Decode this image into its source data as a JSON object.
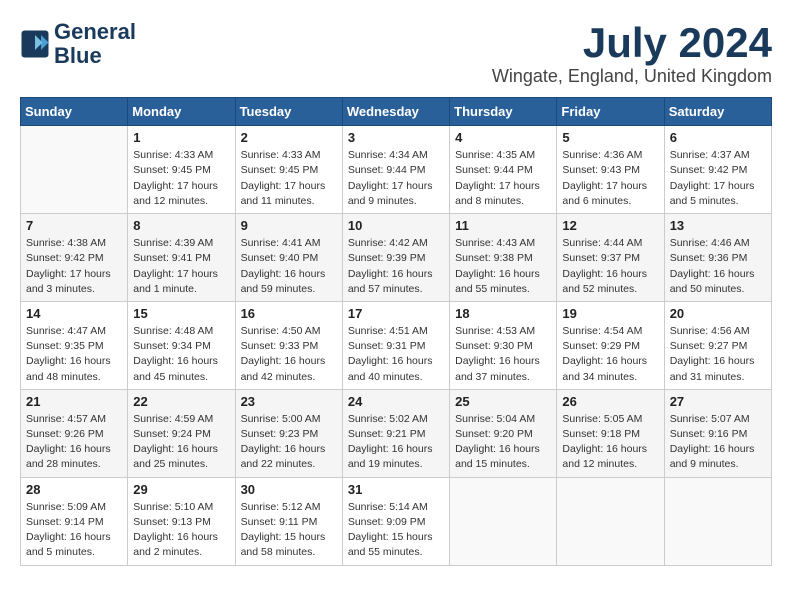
{
  "logo": {
    "line1": "General",
    "line2": "Blue"
  },
  "title": "July 2024",
  "location": "Wingate, England, United Kingdom",
  "days_header": [
    "Sunday",
    "Monday",
    "Tuesday",
    "Wednesday",
    "Thursday",
    "Friday",
    "Saturday"
  ],
  "weeks": [
    [
      {
        "day": "",
        "sun": "",
        "rise": "",
        "set": "",
        "daylight": ""
      },
      {
        "day": "1",
        "rise": "Sunrise: 4:33 AM",
        "set": "Sunset: 9:45 PM",
        "daylight": "Daylight: 17 hours and 12 minutes."
      },
      {
        "day": "2",
        "rise": "Sunrise: 4:33 AM",
        "set": "Sunset: 9:45 PM",
        "daylight": "Daylight: 17 hours and 11 minutes."
      },
      {
        "day": "3",
        "rise": "Sunrise: 4:34 AM",
        "set": "Sunset: 9:44 PM",
        "daylight": "Daylight: 17 hours and 9 minutes."
      },
      {
        "day": "4",
        "rise": "Sunrise: 4:35 AM",
        "set": "Sunset: 9:44 PM",
        "daylight": "Daylight: 17 hours and 8 minutes."
      },
      {
        "day": "5",
        "rise": "Sunrise: 4:36 AM",
        "set": "Sunset: 9:43 PM",
        "daylight": "Daylight: 17 hours and 6 minutes."
      },
      {
        "day": "6",
        "rise": "Sunrise: 4:37 AM",
        "set": "Sunset: 9:42 PM",
        "daylight": "Daylight: 17 hours and 5 minutes."
      }
    ],
    [
      {
        "day": "7",
        "rise": "Sunrise: 4:38 AM",
        "set": "Sunset: 9:42 PM",
        "daylight": "Daylight: 17 hours and 3 minutes."
      },
      {
        "day": "8",
        "rise": "Sunrise: 4:39 AM",
        "set": "Sunset: 9:41 PM",
        "daylight": "Daylight: 17 hours and 1 minute."
      },
      {
        "day": "9",
        "rise": "Sunrise: 4:41 AM",
        "set": "Sunset: 9:40 PM",
        "daylight": "Daylight: 16 hours and 59 minutes."
      },
      {
        "day": "10",
        "rise": "Sunrise: 4:42 AM",
        "set": "Sunset: 9:39 PM",
        "daylight": "Daylight: 16 hours and 57 minutes."
      },
      {
        "day": "11",
        "rise": "Sunrise: 4:43 AM",
        "set": "Sunset: 9:38 PM",
        "daylight": "Daylight: 16 hours and 55 minutes."
      },
      {
        "day": "12",
        "rise": "Sunrise: 4:44 AM",
        "set": "Sunset: 9:37 PM",
        "daylight": "Daylight: 16 hours and 52 minutes."
      },
      {
        "day": "13",
        "rise": "Sunrise: 4:46 AM",
        "set": "Sunset: 9:36 PM",
        "daylight": "Daylight: 16 hours and 50 minutes."
      }
    ],
    [
      {
        "day": "14",
        "rise": "Sunrise: 4:47 AM",
        "set": "Sunset: 9:35 PM",
        "daylight": "Daylight: 16 hours and 48 minutes."
      },
      {
        "day": "15",
        "rise": "Sunrise: 4:48 AM",
        "set": "Sunset: 9:34 PM",
        "daylight": "Daylight: 16 hours and 45 minutes."
      },
      {
        "day": "16",
        "rise": "Sunrise: 4:50 AM",
        "set": "Sunset: 9:33 PM",
        "daylight": "Daylight: 16 hours and 42 minutes."
      },
      {
        "day": "17",
        "rise": "Sunrise: 4:51 AM",
        "set": "Sunset: 9:31 PM",
        "daylight": "Daylight: 16 hours and 40 minutes."
      },
      {
        "day": "18",
        "rise": "Sunrise: 4:53 AM",
        "set": "Sunset: 9:30 PM",
        "daylight": "Daylight: 16 hours and 37 minutes."
      },
      {
        "day": "19",
        "rise": "Sunrise: 4:54 AM",
        "set": "Sunset: 9:29 PM",
        "daylight": "Daylight: 16 hours and 34 minutes."
      },
      {
        "day": "20",
        "rise": "Sunrise: 4:56 AM",
        "set": "Sunset: 9:27 PM",
        "daylight": "Daylight: 16 hours and 31 minutes."
      }
    ],
    [
      {
        "day": "21",
        "rise": "Sunrise: 4:57 AM",
        "set": "Sunset: 9:26 PM",
        "daylight": "Daylight: 16 hours and 28 minutes."
      },
      {
        "day": "22",
        "rise": "Sunrise: 4:59 AM",
        "set": "Sunset: 9:24 PM",
        "daylight": "Daylight: 16 hours and 25 minutes."
      },
      {
        "day": "23",
        "rise": "Sunrise: 5:00 AM",
        "set": "Sunset: 9:23 PM",
        "daylight": "Daylight: 16 hours and 22 minutes."
      },
      {
        "day": "24",
        "rise": "Sunrise: 5:02 AM",
        "set": "Sunset: 9:21 PM",
        "daylight": "Daylight: 16 hours and 19 minutes."
      },
      {
        "day": "25",
        "rise": "Sunrise: 5:04 AM",
        "set": "Sunset: 9:20 PM",
        "daylight": "Daylight: 16 hours and 15 minutes."
      },
      {
        "day": "26",
        "rise": "Sunrise: 5:05 AM",
        "set": "Sunset: 9:18 PM",
        "daylight": "Daylight: 16 hours and 12 minutes."
      },
      {
        "day": "27",
        "rise": "Sunrise: 5:07 AM",
        "set": "Sunset: 9:16 PM",
        "daylight": "Daylight: 16 hours and 9 minutes."
      }
    ],
    [
      {
        "day": "28",
        "rise": "Sunrise: 5:09 AM",
        "set": "Sunset: 9:14 PM",
        "daylight": "Daylight: 16 hours and 5 minutes."
      },
      {
        "day": "29",
        "rise": "Sunrise: 5:10 AM",
        "set": "Sunset: 9:13 PM",
        "daylight": "Daylight: 16 hours and 2 minutes."
      },
      {
        "day": "30",
        "rise": "Sunrise: 5:12 AM",
        "set": "Sunset: 9:11 PM",
        "daylight": "Daylight: 15 hours and 58 minutes."
      },
      {
        "day": "31",
        "rise": "Sunrise: 5:14 AM",
        "set": "Sunset: 9:09 PM",
        "daylight": "Daylight: 15 hours and 55 minutes."
      },
      {
        "day": "",
        "rise": "",
        "set": "",
        "daylight": ""
      },
      {
        "day": "",
        "rise": "",
        "set": "",
        "daylight": ""
      },
      {
        "day": "",
        "rise": "",
        "set": "",
        "daylight": ""
      }
    ]
  ]
}
